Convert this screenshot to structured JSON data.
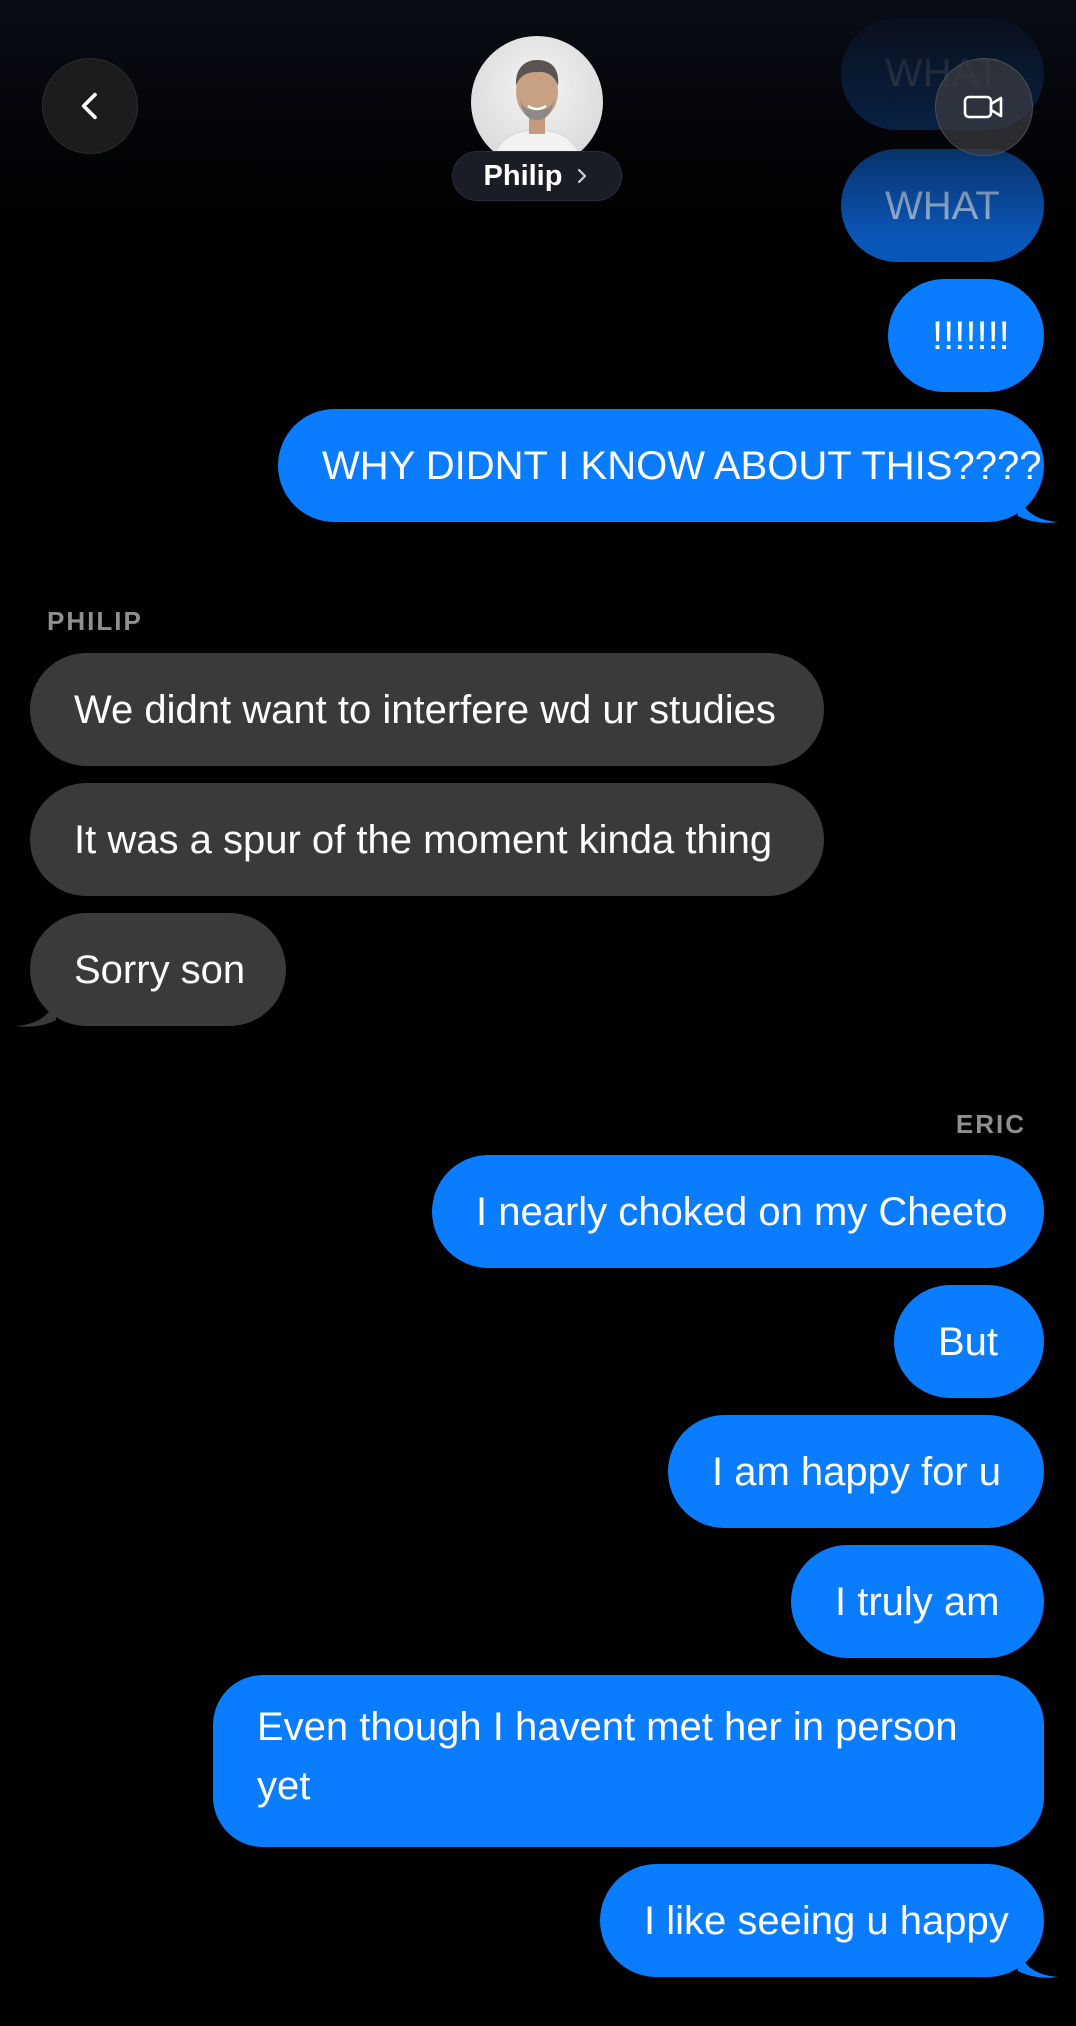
{
  "header": {
    "contact_name": "Philip",
    "back_icon": "chevron-left-icon",
    "video_icon": "video-camera-icon",
    "name_chevron_icon": "chevron-right-icon"
  },
  "colors": {
    "background": "#000000",
    "outgoing_bubble": "#0a7cff",
    "incoming_bubble": "#3a3a3c",
    "sender_label": "#8e8e93"
  },
  "messages": [
    {
      "direction": "outgoing",
      "text": "WHAT",
      "faded": true
    },
    {
      "direction": "outgoing",
      "text": "WHAT",
      "faded": true
    },
    {
      "direction": "outgoing",
      "text": "!!!!!!!"
    },
    {
      "direction": "outgoing",
      "text": "WHY DIDNT I KNOW ABOUT THIS????"
    },
    {
      "direction": "incoming",
      "text": "We didnt want to interfere wd ur studies"
    },
    {
      "direction": "incoming",
      "text": "It was a spur of the moment kinda thing"
    },
    {
      "direction": "incoming",
      "text": "Sorry son"
    },
    {
      "direction": "outgoing",
      "text": "I nearly choked on my Cheeto"
    },
    {
      "direction": "outgoing",
      "text": "But"
    },
    {
      "direction": "outgoing",
      "text": "I am happy for u"
    },
    {
      "direction": "outgoing",
      "text": "I truly am"
    },
    {
      "direction": "outgoing",
      "text": "Even though I havent met her in person yet"
    },
    {
      "direction": "outgoing",
      "text": "I like seeing u happy"
    }
  ],
  "senders": {
    "incoming": "PHILIP",
    "outgoing": "ERIC"
  }
}
